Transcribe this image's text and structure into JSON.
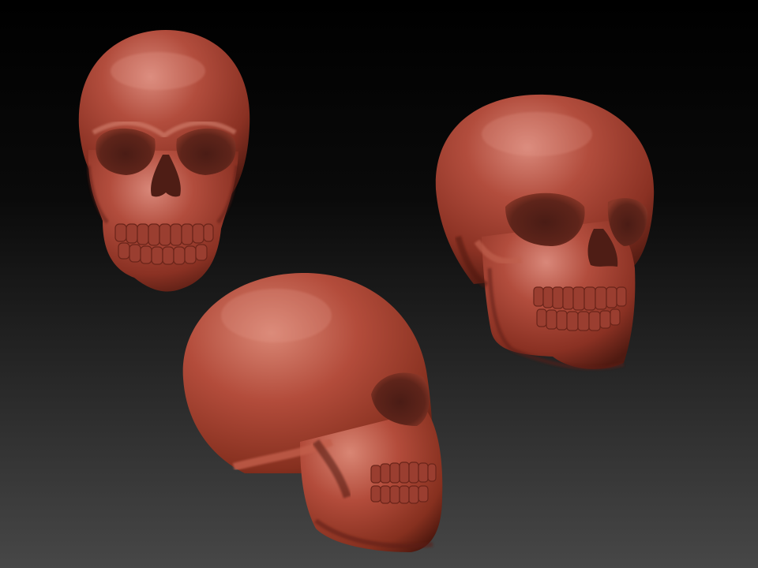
{
  "scene": {
    "subject": "skull",
    "views": [
      {
        "view": "front"
      },
      {
        "view": "three-quarter"
      },
      {
        "view": "side"
      }
    ]
  },
  "colors": {
    "material": "#b04a3a",
    "material_highlight": "#d98a78",
    "material_shadow": "#3a120c",
    "background_top": "#000000",
    "background_bottom": "#474747"
  }
}
